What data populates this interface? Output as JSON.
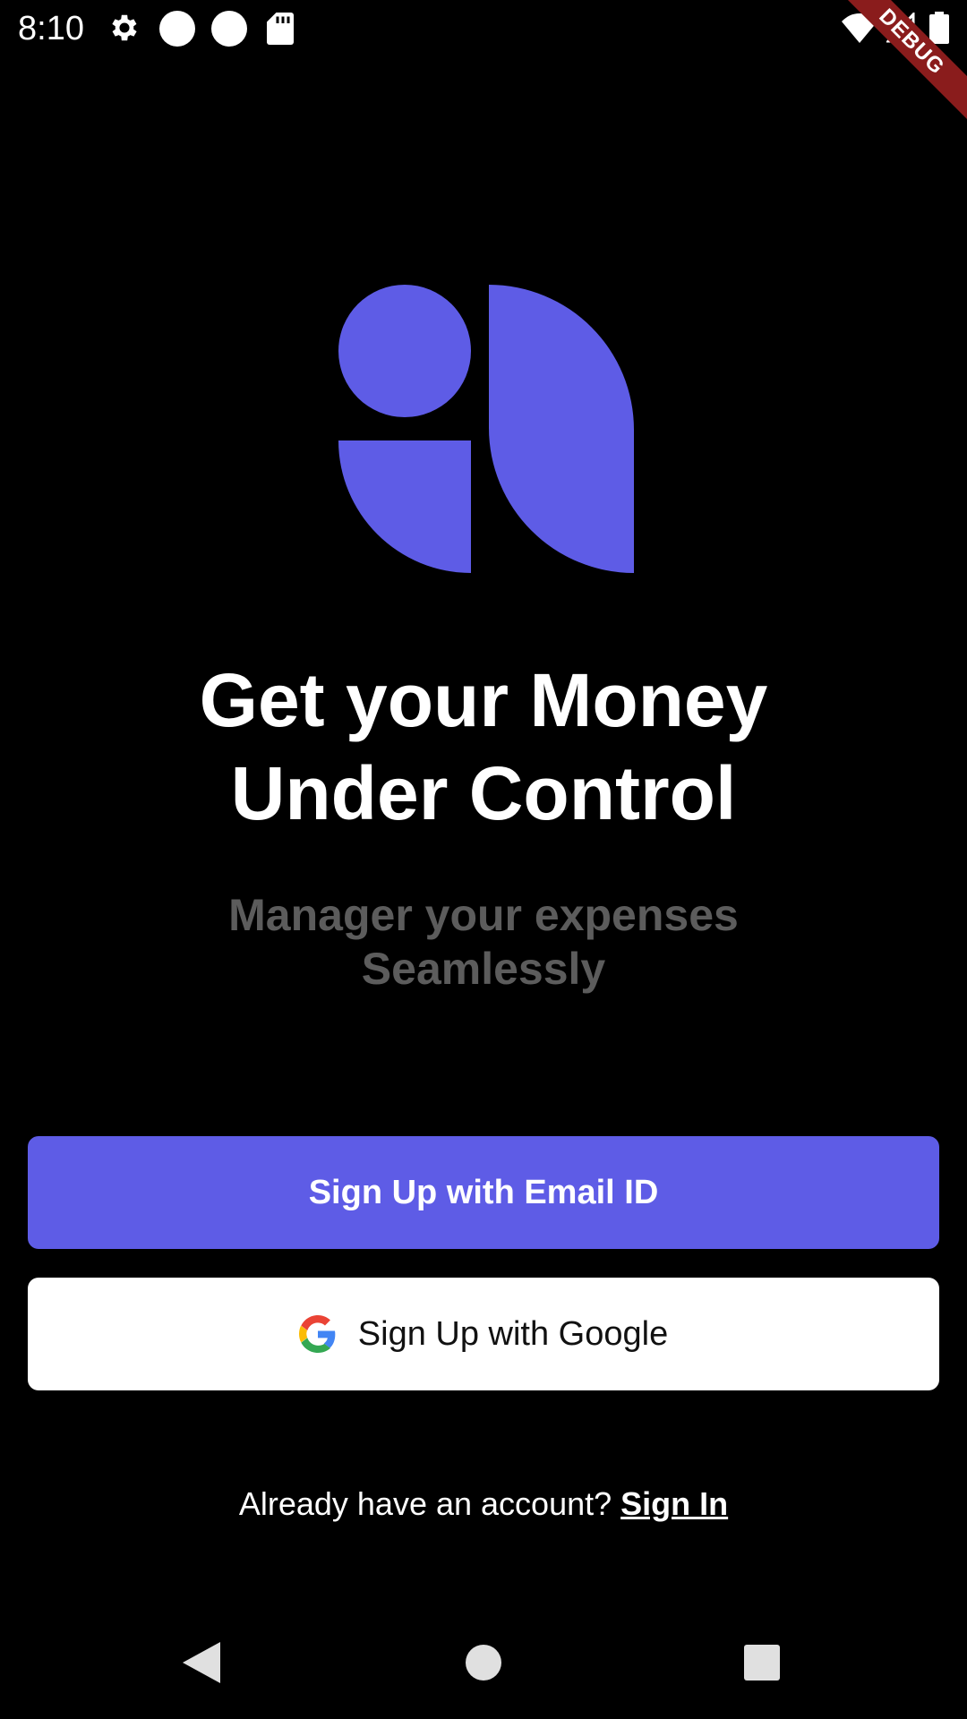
{
  "status_bar": {
    "time": "8:10",
    "icons": [
      "gear-icon",
      "circle-icon",
      "circle-icon",
      "sd-card-icon",
      "wifi-icon",
      "signal-icon",
      "battery-icon"
    ]
  },
  "debug_ribbon": {
    "label": "DEBUG",
    "color": "#8a1c1c"
  },
  "hero": {
    "logo_color": "#5e5ce6",
    "headline_line1": "Get your Money",
    "headline_line2": "Under Control",
    "subtitle_line1": "Manager your expenses",
    "subtitle_line2": "Seamlessly"
  },
  "actions": {
    "email_button_label": "Sign Up with Email ID",
    "google_button_label": "Sign Up with Google",
    "email_button_color": "#5e5ce6"
  },
  "footer": {
    "prompt": "Already have an account? ",
    "signin_label": "Sign In"
  },
  "nav_bar": {
    "icons": [
      "back-icon",
      "home-icon",
      "recents-icon"
    ]
  }
}
